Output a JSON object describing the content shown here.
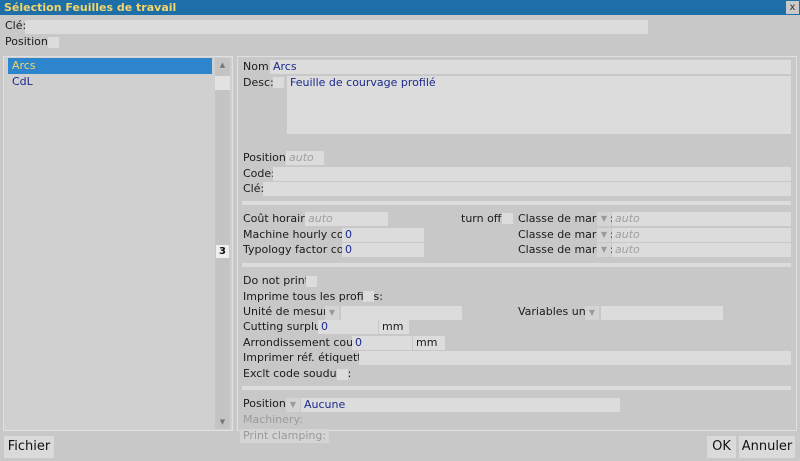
{
  "window": {
    "title": "Sélection Feuilles de travail",
    "close_glyph": "x"
  },
  "header": {
    "cle_label": "Clé:",
    "cle_value": "",
    "position_label": "Position:"
  },
  "list": {
    "items": [
      {
        "label": "Arcs",
        "selected": true
      },
      {
        "label": "CdL",
        "selected": false
      }
    ],
    "scroll_badge": "3",
    "up_glyph": "▲",
    "down_glyph": "▼"
  },
  "detail": {
    "nom_label": "Nom:",
    "nom_value": "Arcs",
    "desc_label": "Desc:",
    "desc_value": "Feuille de courvage profilé",
    "position_label": "Position:",
    "position_placeholder": "auto",
    "code_label": "Code:",
    "cle_label": "Clé:",
    "cout_label": "Coût horaire:",
    "cout_placeholder": "auto",
    "turnoff_label": "turn off:",
    "classe_label": "Classe de marge:",
    "classe_placeholder": "auto",
    "machine_label": "Machine hourly cost:",
    "machine_value": "0",
    "typology_label": "Typology factor cost:",
    "typology_value": "0",
    "donotprint_label": "Do not print:",
    "imprime_label": "Imprime tous les profilés:",
    "unite_label": "Unité de mesure:",
    "variables_label": "Variables unit:",
    "cutting_label": "Cutting surplus:",
    "cutting_value": "0",
    "cutting_unit": "mm",
    "arrondissement_label": "Arrondissement coupe:",
    "arrondissement_value": "0",
    "arrondissement_unit": "mm",
    "imprimer_ref_label": "Imprimer réf. étiquettes:",
    "exclt_label": "Exclt code soudure:",
    "position2_label": "Position:",
    "position2_value": "Aucune",
    "machinery_label": "Machinery:",
    "print_clamping_label": "Print clamping:",
    "dropdown_glyph": "▼"
  },
  "footer": {
    "fichier_label": "Fichier",
    "ok_label": "OK",
    "annuler_label": "Annuler"
  }
}
